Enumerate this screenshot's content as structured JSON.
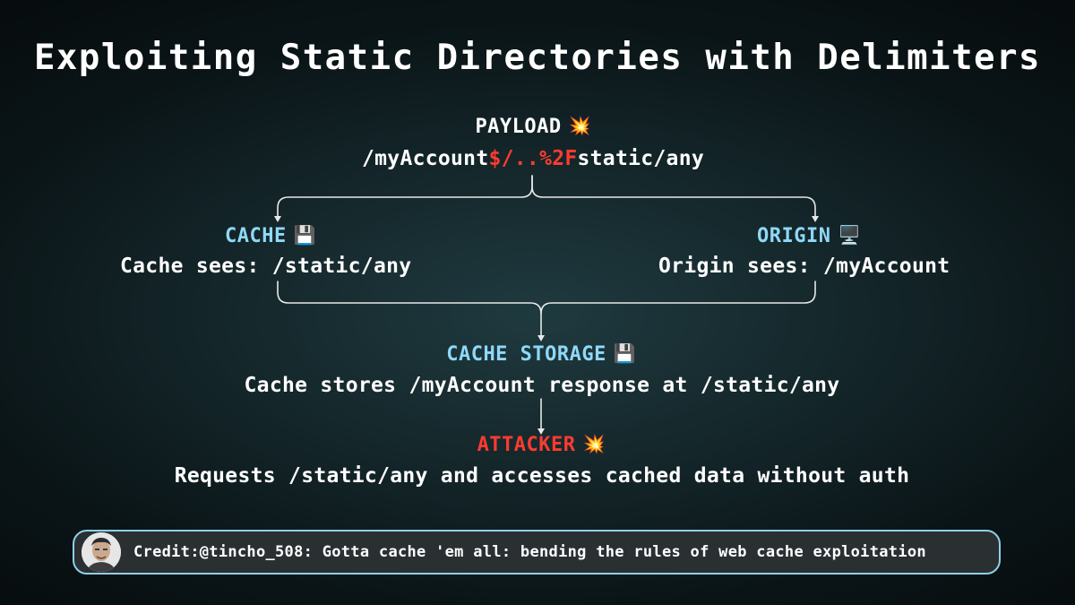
{
  "title": "Exploiting Static Directories with Delimiters",
  "payload": {
    "label": "PAYLOAD",
    "icon": "explosion-icon",
    "path_start": "/myAccount",
    "path_delimiters": "$/..%2F",
    "path_end": "static/any"
  },
  "cache": {
    "label": "CACHE",
    "icon": "floppy-disk-icon",
    "text": "Cache sees: /static/any"
  },
  "origin": {
    "label": "ORIGIN",
    "icon": "computer-monitor-icon",
    "text": "Origin sees: /myAccount"
  },
  "cache_storage": {
    "label": "CACHE STORAGE",
    "icon": "floppy-disk-icon",
    "text": "Cache stores /myAccount response at /static/any"
  },
  "attacker": {
    "label": "ATTACKER",
    "icon": "explosion-icon",
    "text": "Requests /static/any and accesses cached data without auth"
  },
  "credit": {
    "text": "Credit:@tincho_508: Gotta cache 'em all: bending the rules of web cache exploitation"
  },
  "colors": {
    "accent_cyan": "#8fd8f8",
    "accent_red": "#ff3b30",
    "text": "#ffffff",
    "connector": "#e8e8e8"
  }
}
